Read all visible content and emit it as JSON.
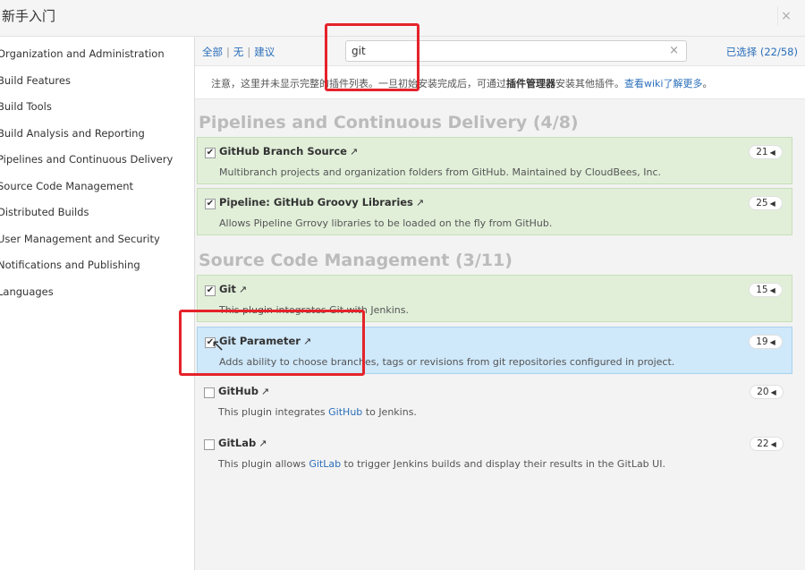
{
  "window": {
    "title": "新手入门",
    "close_label": "×"
  },
  "sidebar": {
    "items": [
      "Organization and Administration",
      "Build Features",
      "Build Tools",
      "Build Analysis and Reporting",
      "Pipelines and Continuous Delivery",
      "Source Code Management",
      "Distributed Builds",
      "User Management and Security",
      "Notifications and Publishing",
      "Languages"
    ]
  },
  "toolbar": {
    "filter_all": "全部",
    "filter_none": "无",
    "filter_suggested": "建议",
    "sep": "|",
    "search_value": "git",
    "clear_label": "×",
    "selected_label": "已选择 (22/58)"
  },
  "notice": {
    "prefix": "注意，这里并未显示完整的插件列表。一旦初始安装完成后，可通过",
    "bold": "插件管理器",
    "middle": "安装其他插件。",
    "link": "查看wiki了解更多",
    "suffix": "。"
  },
  "groups": [
    {
      "title": "Pipelines and Continuous Delivery (4/8)"
    },
    {
      "title": "Source Code Management (3/11)"
    }
  ],
  "plugins": [
    {
      "name": "GitHub Branch Source",
      "ext": "↗",
      "desc": "Multibranch projects and organization folders from GitHub. Maintained by CloudBees, Inc.",
      "count": "21",
      "checked": "✔"
    },
    {
      "name": "Pipeline: GitHub Groovy Libraries",
      "ext": "↗",
      "desc": "Allows Pipeline Grrovy libraries to be loaded on the fly from GitHub.",
      "count": "25",
      "checked": "✔"
    },
    {
      "name": "Git",
      "ext": "↗",
      "desc": "This plugin integrates Git with Jenkins.",
      "count": "15",
      "checked": "✔"
    },
    {
      "name": "Git Parameter",
      "ext": "↗",
      "desc": "Adds ability to choose branches, tags or revisions from git repositories configured in project.",
      "count": "19",
      "checked": "✔"
    },
    {
      "name": "GitHub",
      "ext": "↗",
      "desc_pre": "This plugin integrates ",
      "desc_link": "GitHub",
      "desc_post": " to Jenkins.",
      "count": "20",
      "checked": ""
    },
    {
      "name": "GitLab",
      "ext": "↗",
      "desc_pre": "This plugin allows ",
      "desc_link": "GitLab",
      "desc_post": " to trigger Jenkins builds and display their results in the GitLab UI.",
      "count": "22",
      "checked": ""
    }
  ],
  "badge_arrow": "◀",
  "cursor_glyph": "↖",
  "colors": {
    "installed_bg": "#e1efd9",
    "selected_bg": "#cfe8fa",
    "link": "#2a6eba",
    "highlight": "#e5232a"
  }
}
